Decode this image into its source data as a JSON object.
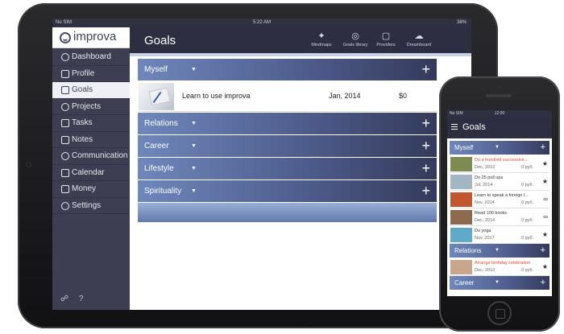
{
  "ipad": {
    "statusbar": {
      "carrier": "No SIM",
      "time": "5:22 AM",
      "battery": "38%"
    },
    "logo": "improva",
    "nav": [
      {
        "label": "Dashboard",
        "icon": "dashboard-icon"
      },
      {
        "label": "Profile",
        "icon": "profile-icon"
      },
      {
        "label": "Goals",
        "icon": "goals-icon",
        "active": true
      },
      {
        "label": "Projects",
        "icon": "projects-icon"
      },
      {
        "label": "Tasks",
        "icon": "tasks-icon"
      },
      {
        "label": "Notes",
        "icon": "notes-icon"
      },
      {
        "label": "Communication",
        "icon": "communication-icon"
      },
      {
        "label": "Calendar",
        "icon": "calendar-icon"
      },
      {
        "label": "Money",
        "icon": "money-icon"
      },
      {
        "label": "Settings",
        "icon": "settings-icon"
      }
    ],
    "header": {
      "title": "Goals",
      "actions": [
        {
          "label": "Mindmaps",
          "icon": "mindmaps-icon"
        },
        {
          "label": "Goals library",
          "icon": "goals-library-icon"
        },
        {
          "label": "Providers",
          "icon": "cart-icon"
        },
        {
          "label": "Dreamboard",
          "icon": "dreamboard-icon"
        }
      ]
    },
    "groups": [
      {
        "name": "Myself",
        "goals": [
          {
            "name": "Learn to use improva",
            "date": "Jan, 2014",
            "cost": "$0"
          }
        ]
      },
      {
        "name": "Relations",
        "goals": []
      },
      {
        "name": "Career",
        "goals": []
      },
      {
        "name": "Lifestyle",
        "goals": []
      },
      {
        "name": "Spirituality",
        "goals": []
      }
    ],
    "plus": "+",
    "caret": "▼"
  },
  "iphone": {
    "statusbar": {
      "carrier": "No SIM",
      "time": "12:00"
    },
    "title": "Goals",
    "groups": [
      {
        "name": "Myself",
        "goals": [
          {
            "name": "Do a hundred successive...",
            "date": "Dec, 2013",
            "price": "0 руб.",
            "highlight": true,
            "thumb": "#7d8a52"
          },
          {
            "name": "Do 25 pull ups",
            "date": "Jul, 2014",
            "price": "0 руб.",
            "highlight": false,
            "thumb": "#a3b6c4"
          },
          {
            "name": "Learn to speak a foreign l...",
            "date": "Nov, 2014",
            "price": "0 руб.",
            "highlight": false,
            "thumb": "#c2562f"
          },
          {
            "name": "Read 100 books",
            "date": "Dec, 2014",
            "price": "0 руб.",
            "highlight": false,
            "thumb": "#8c6a4e"
          },
          {
            "name": "Do yoga",
            "date": "Nov, 2017",
            "price": "0 руб.",
            "highlight": false,
            "thumb": "#5fa9c9"
          }
        ]
      },
      {
        "name": "Relations",
        "goals": [
          {
            "name": "Arrange birthday celebration",
            "date": "Dec, 2013",
            "price": "0 руб.",
            "highlight": true,
            "thumb": "#c9a58c"
          }
        ]
      },
      {
        "name": "Career",
        "goals": []
      }
    ]
  },
  "colors": {
    "accent": "#4f5d8d",
    "sidebar": "#3d3e51",
    "header": "#2d2e42",
    "highlight": "#e0452f"
  }
}
